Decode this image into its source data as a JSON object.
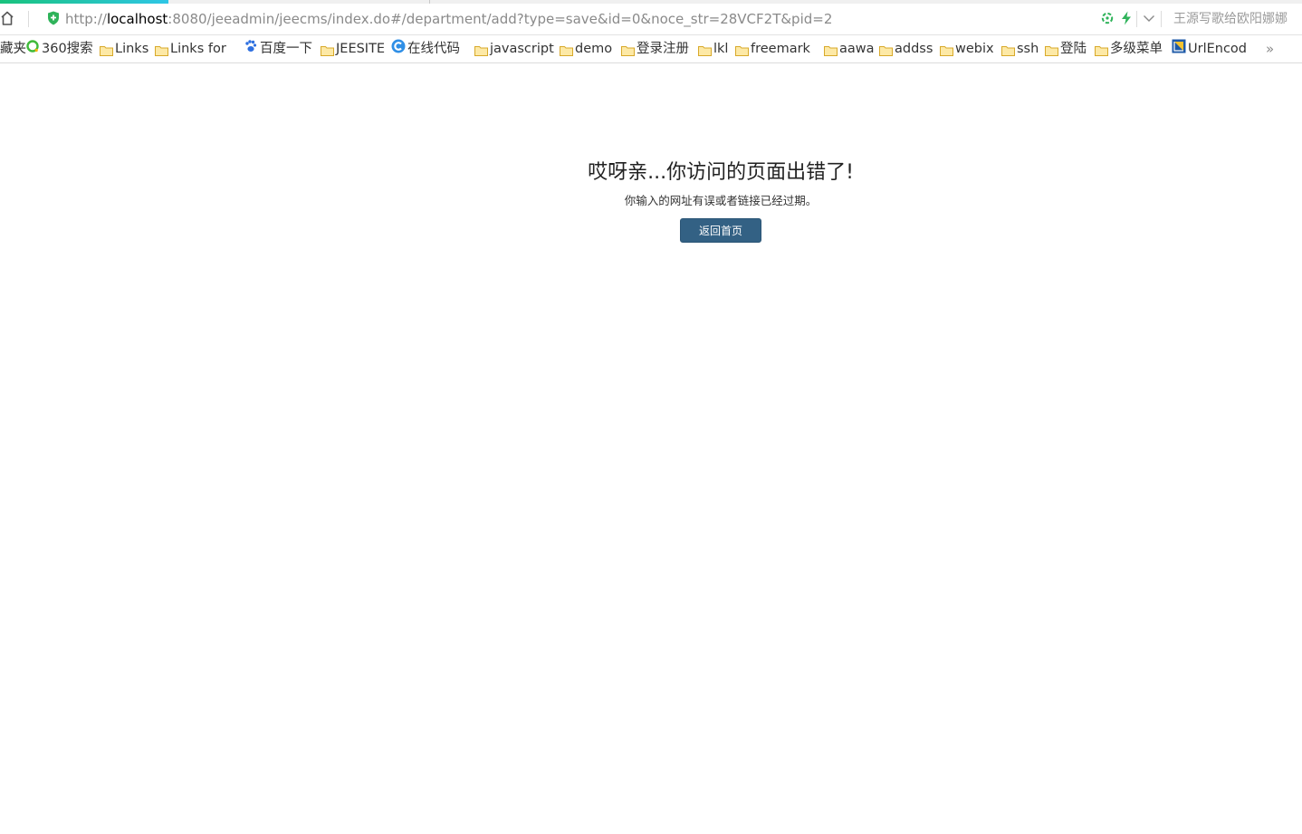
{
  "browser": {
    "url_prefix": "http://",
    "url_host": "localhost",
    "url_rest": ":8080/jeeadmin/jeecms/index.do#/department/add?type=save&id=0&noce_str=28VCF2T&pid=2",
    "user_name": "王源写歌给欧阳娜娜",
    "more_label": "»"
  },
  "bookmarks": [
    {
      "label": "藏夹",
      "icon": "none"
    },
    {
      "label": "360搜索",
      "icon": "360-icon"
    },
    {
      "label": "Links",
      "icon": "folder-icon"
    },
    {
      "label": "Links for",
      "icon": "folder-icon"
    },
    {
      "label": "百度一下",
      "icon": "baidu-paw-icon"
    },
    {
      "label": "JEESITE",
      "icon": "folder-icon"
    },
    {
      "label": "在线代码",
      "icon": "c-logo-icon"
    },
    {
      "label": "javascript",
      "icon": "folder-icon"
    },
    {
      "label": "demo",
      "icon": "folder-icon"
    },
    {
      "label": "登录注册",
      "icon": "folder-icon"
    },
    {
      "label": "lkl",
      "icon": "folder-icon"
    },
    {
      "label": "freemark",
      "icon": "folder-icon"
    },
    {
      "label": "aawa",
      "icon": "folder-icon"
    },
    {
      "label": "addss",
      "icon": "folder-icon"
    },
    {
      "label": "webix",
      "icon": "folder-icon"
    },
    {
      "label": "ssh",
      "icon": "folder-icon"
    },
    {
      "label": "登陆",
      "icon": "folder-icon"
    },
    {
      "label": "多级菜单",
      "icon": "folder-icon"
    },
    {
      "label": "UrlEncod",
      "icon": "urlencode-icon"
    }
  ],
  "page": {
    "title": "哎呀亲...你访问的页面出错了!",
    "subtitle": "你输入的网址有误或者链接已经过期。",
    "home_button": "返回首页"
  },
  "colors": {
    "button": "#336184",
    "progress_start": "#19c37d",
    "progress_end": "#2ec6e6",
    "folder": "#f5c542"
  }
}
